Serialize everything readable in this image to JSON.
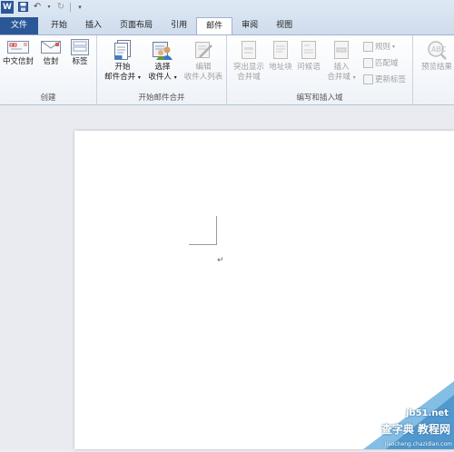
{
  "app": {
    "icon_letter": "W"
  },
  "tabs": [
    "文件",
    "开始",
    "插入",
    "页面布局",
    "引用",
    "邮件",
    "审阅",
    "视图"
  ],
  "groups": {
    "create": {
      "label": "创建",
      "buttons": [
        "中文信封",
        "信封",
        "标签"
      ]
    },
    "start_merge": {
      "label": "开始邮件合并",
      "start_line1": "开始",
      "start_line2": "邮件合并",
      "select_line1": "选择",
      "select_line2": "收件人",
      "edit_line1": "编辑",
      "edit_line2": "收件人列表"
    },
    "write_insert": {
      "label": "编写和插入域",
      "highlight_line1": "突出显示",
      "highlight_line2": "合并域",
      "address_block": "地址块",
      "greeting": "问候语",
      "insert_line1": "插入",
      "insert_line2": "合并域",
      "rules": "规则",
      "match_fields": "匹配域",
      "update_labels": "更新标签"
    },
    "preview": {
      "label": "预览结果"
    }
  },
  "document": {
    "paragraph_mark": "↵"
  },
  "watermark": {
    "line1": "jb51.net",
    "line2": "查字典 教程网",
    "line3": "jiaocheng.chazidian.com"
  },
  "colors": {
    "file_tab": "#2b5797",
    "accent": "#2b5797"
  }
}
